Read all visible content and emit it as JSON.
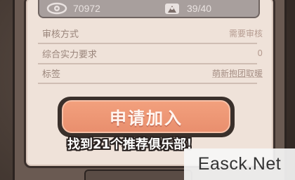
{
  "stats": {
    "views": "70972",
    "members": "39/40",
    "views_icon": "eye-icon",
    "members_icon": "member-badge-icon"
  },
  "info_rows": [
    {
      "label": "审核方式",
      "value": "需要审核"
    },
    {
      "label": "综合实力要求",
      "value": "0"
    },
    {
      "label": "标签",
      "value": "萌新抱团取暖"
    }
  ],
  "join_button": {
    "label": "申请加入"
  },
  "hint": "找到21个推荐俱乐部！",
  "watermark": "Easck.Net",
  "colors": {
    "panel_bg": "#efe2d9",
    "button_bg": "#e98f6e",
    "label": "#9a857b",
    "value": "#b69c91",
    "strip": "#a89f9d"
  }
}
